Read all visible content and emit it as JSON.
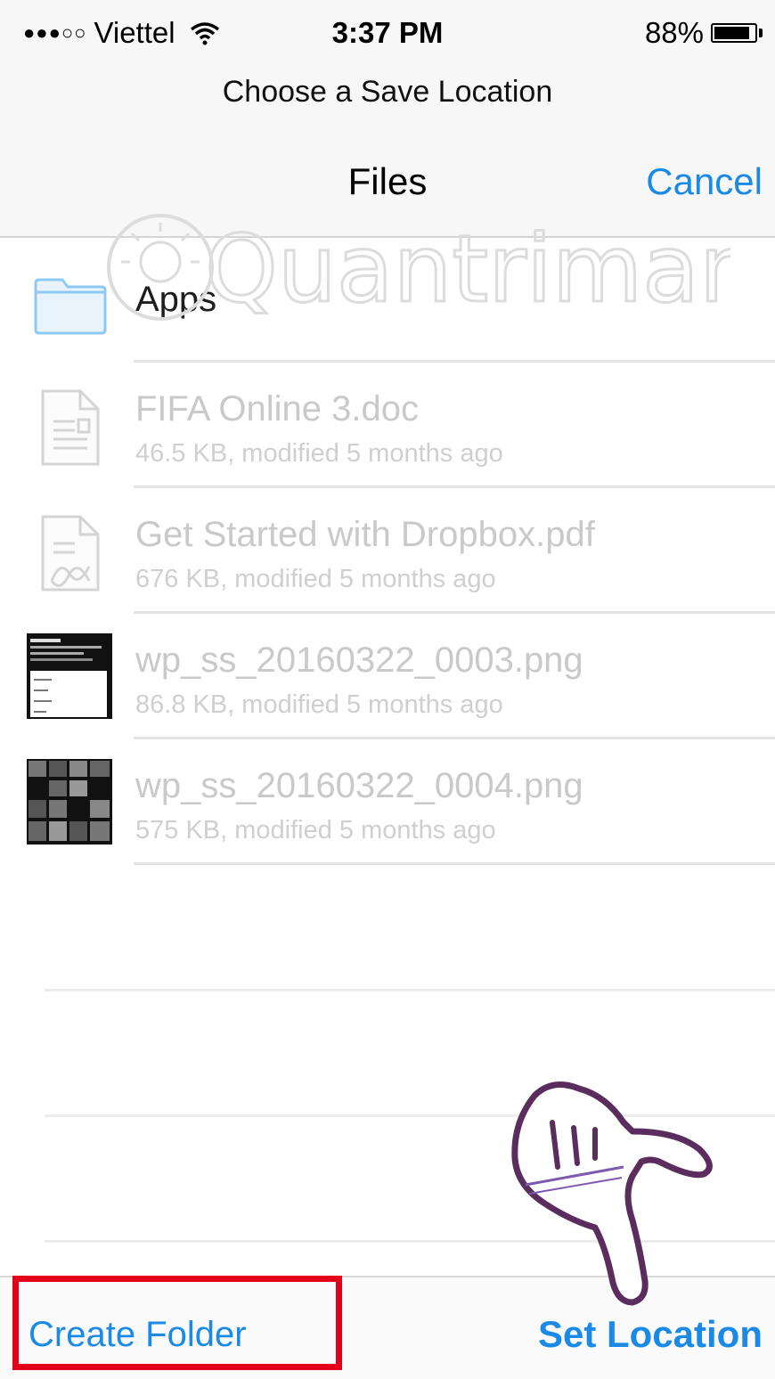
{
  "status_bar": {
    "signal": "●●●○○",
    "carrier": "Viettel",
    "time": "3:37 PM",
    "battery": "88%",
    "battery_level": 0.88
  },
  "header": {
    "prompt": "Choose a Save Location",
    "title": "Files",
    "cancel_label": "Cancel"
  },
  "files": [
    {
      "name": "Apps",
      "kind": "folder"
    },
    {
      "name": "FIFA Online 3.doc",
      "meta": "46.5 KB, modified 5 months ago",
      "kind": "doc"
    },
    {
      "name": "Get Started with Dropbox.pdf",
      "meta": "676 KB, modified 5 months ago",
      "kind": "pdf"
    },
    {
      "name": "wp_ss_20160322_0003.png",
      "meta": "86.8 KB, modified 5 months ago",
      "kind": "image-screenshot"
    },
    {
      "name": "wp_ss_20160322_0004.png",
      "meta": "575 KB, modified 5 months ago",
      "kind": "image-tiles"
    }
  ],
  "toolbar": {
    "create_folder_label": "Create Folder",
    "set_location_label": "Set Location"
  },
  "watermark": {
    "text": "Quantrimang"
  },
  "colors": {
    "accent": "#1a8ae6",
    "highlight": "#e5001a",
    "folder": "#8fc8f2"
  }
}
